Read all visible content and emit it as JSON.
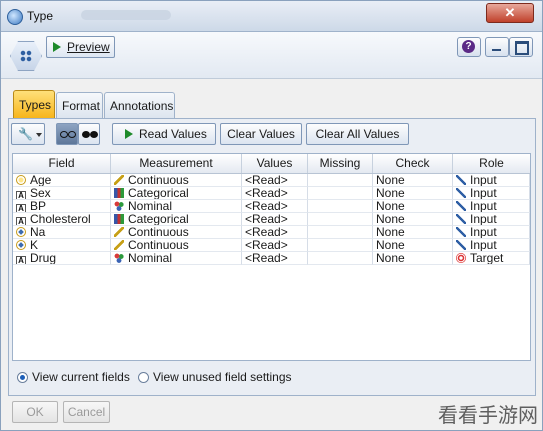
{
  "window": {
    "title": "Type",
    "close_glyph": "✕"
  },
  "toolbar": {
    "preview_label": "Preview",
    "help_glyph": "?"
  },
  "tabs": [
    {
      "label": "Types",
      "active": true
    },
    {
      "label": "Format",
      "active": false
    },
    {
      "label": "Annotations",
      "active": false
    }
  ],
  "actions": {
    "read_values": "Read Values",
    "clear_values": "Clear Values",
    "clear_all_values": "Clear All Values"
  },
  "table": {
    "headers": [
      "Field",
      "Measurement",
      "Values",
      "Missing",
      "Check",
      "Role"
    ],
    "rows": [
      {
        "field": "Age",
        "field_icon": "continuous-icon",
        "measurement": "Continuous",
        "measurement_icon": "ruler-icon",
        "values": "<Read>",
        "missing": "",
        "check": "None",
        "role": "Input",
        "role_icon": "input-arrow-icon"
      },
      {
        "field": "Sex",
        "field_icon": "string-icon",
        "measurement": "Categorical",
        "measurement_icon": "categorical-icon",
        "values": "<Read>",
        "missing": "",
        "check": "None",
        "role": "Input",
        "role_icon": "input-arrow-icon"
      },
      {
        "field": "BP",
        "field_icon": "string-icon",
        "measurement": "Nominal",
        "measurement_icon": "nominal-icon",
        "values": "<Read>",
        "missing": "",
        "check": "None",
        "role": "Input",
        "role_icon": "input-arrow-icon"
      },
      {
        "field": "Cholesterol",
        "field_icon": "string-icon",
        "measurement": "Categorical",
        "measurement_icon": "categorical-icon",
        "values": "<Read>",
        "missing": "",
        "check": "None",
        "role": "Input",
        "role_icon": "input-arrow-icon"
      },
      {
        "field": "Na",
        "field_icon": "real-icon",
        "measurement": "Continuous",
        "measurement_icon": "ruler-icon",
        "values": "<Read>",
        "missing": "",
        "check": "None",
        "role": "Input",
        "role_icon": "input-arrow-icon"
      },
      {
        "field": "K",
        "field_icon": "real-icon",
        "measurement": "Continuous",
        "measurement_icon": "ruler-icon",
        "values": "<Read>",
        "missing": "",
        "check": "None",
        "role": "Input",
        "role_icon": "input-arrow-icon"
      },
      {
        "field": "Drug",
        "field_icon": "string-icon",
        "measurement": "Nominal",
        "measurement_icon": "nominal-icon",
        "values": "<Read>",
        "missing": "",
        "check": "None",
        "role": "Target",
        "role_icon": "target-icon"
      }
    ]
  },
  "view_options": [
    {
      "label": "View current fields",
      "selected": true
    },
    {
      "label": "View unused field settings",
      "selected": false
    }
  ],
  "buttons": {
    "ok": "OK",
    "cancel": "Cancel"
  },
  "watermark": "看看手游网"
}
